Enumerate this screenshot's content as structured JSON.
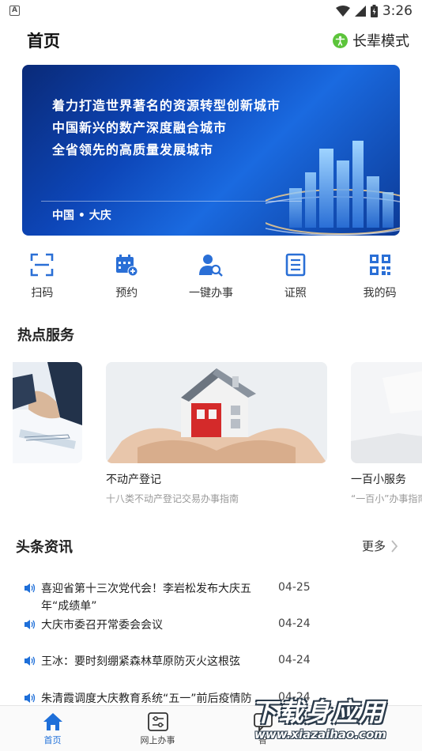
{
  "status_bar": {
    "time": "3:26",
    "notif_glyph": "A"
  },
  "header": {
    "title": "首页",
    "elder_mode_label": "长辈模式"
  },
  "banner": {
    "lines": [
      "着力打造世界著名的资源转型创新城市",
      "中国新兴的数产深度融合城市",
      "全省领先的高质量发展城市"
    ],
    "caption": "中国 • 大庆"
  },
  "quick_actions": [
    {
      "label": "扫码",
      "icon": "scan-icon"
    },
    {
      "label": "预约",
      "icon": "calendar-add-icon"
    },
    {
      "label": "一键办事",
      "icon": "user-search-icon"
    },
    {
      "label": "证照",
      "icon": "document-icon"
    },
    {
      "label": "我的码",
      "icon": "qr-code-icon"
    }
  ],
  "hot_services": {
    "title": "热点服务",
    "cards": [
      {
        "title": "不动产登记",
        "desc": "十八类不动产登记交易办事指南"
      },
      {
        "title": "一百小服务",
        "desc": "“一百小”办事指南"
      }
    ]
  },
  "news": {
    "title": "头条资讯",
    "more_label": "更多",
    "items": [
      {
        "text": "喜迎省第十三次党代会！李岩松发布大庆五年“成绩单”",
        "date": "04-25"
      },
      {
        "text": "大庆市委召开常委会会议",
        "date": "04-24"
      },
      {
        "text": "王冰：要时刻绷紧森林草原防灭火这根弦",
        "date": "04-24"
      },
      {
        "text": "朱清霞调度大庆教育系统“五一”前后疫情防",
        "date": "04-24"
      }
    ]
  },
  "bottom_nav": [
    {
      "label": "首页",
      "icon": "home-icon",
      "active": true
    },
    {
      "label": "网上办事",
      "icon": "settings-panel-icon",
      "active": false
    },
    {
      "label": "智",
      "icon": "chat-icon",
      "active": false
    }
  ],
  "watermark": {
    "main": "下载身应用",
    "url": "www.xiazaihao.com"
  },
  "colors": {
    "accent": "#1e6fd9",
    "icon_blue": "#2a6fd6",
    "elder_green": "#5cc43b"
  }
}
